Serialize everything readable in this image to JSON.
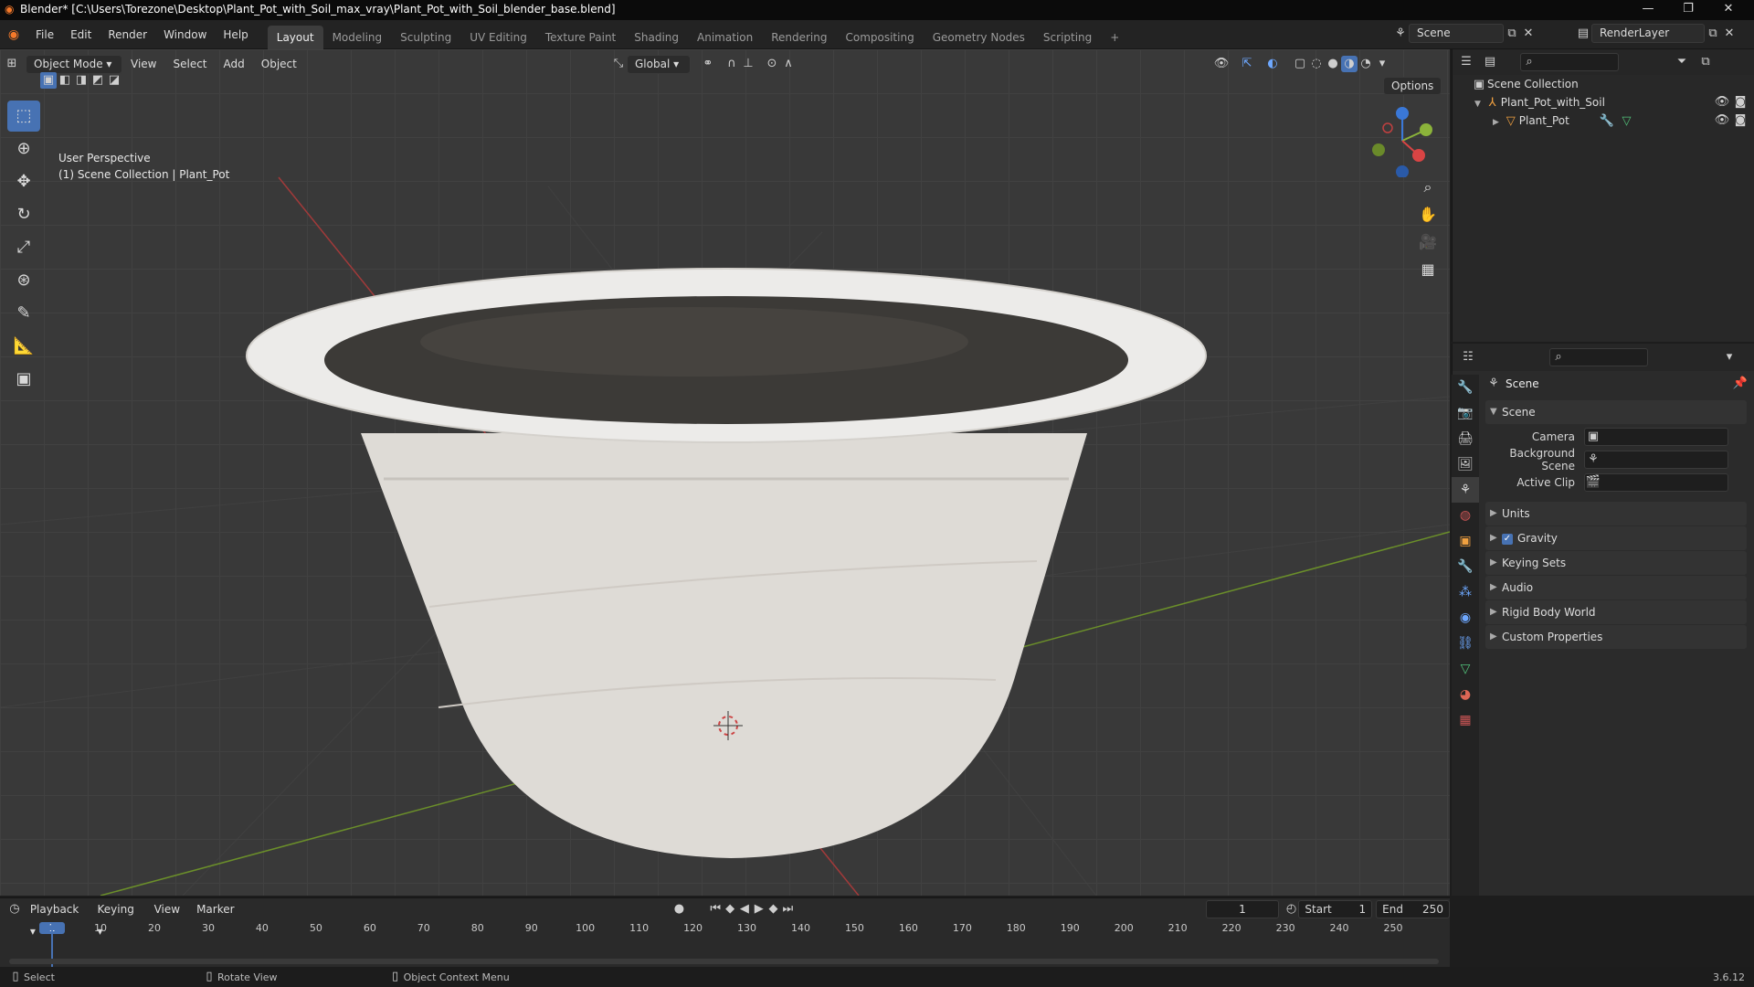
{
  "titlebar": {
    "title": "Blender* [C:\\Users\\Torezone\\Desktop\\Plant_Pot_with_Soil_max_vray\\Plant_Pot_with_Soil_blender_base.blend]"
  },
  "menus": [
    "File",
    "Edit",
    "Render",
    "Window",
    "Help"
  ],
  "workspaces": [
    "Layout",
    "Modeling",
    "Sculpting",
    "UV Editing",
    "Texture Paint",
    "Shading",
    "Animation",
    "Rendering",
    "Compositing",
    "Geometry Nodes",
    "Scripting"
  ],
  "scene": {
    "name": "Scene",
    "render_layer": "RenderLayer"
  },
  "viewport_header": {
    "mode": "Object Mode",
    "menus": [
      "View",
      "Select",
      "Add",
      "Object"
    ],
    "orientation": "Global",
    "options": "Options"
  },
  "viewport": {
    "perspective": "User Perspective",
    "collection_info": "(1) Scene Collection | Plant_Pot"
  },
  "outliner": {
    "root": "Scene Collection",
    "items": [
      "Plant_Pot_with_Soil",
      "Plant_Pot"
    ]
  },
  "properties": {
    "title": "Scene",
    "section": "Scene",
    "fields": {
      "camera": "Camera",
      "background_scene": "Background Scene",
      "active_clip": "Active Clip"
    },
    "panels": [
      "Units",
      "Gravity",
      "Keying Sets",
      "Audio",
      "Rigid Body World",
      "Custom Properties"
    ]
  },
  "timeline": {
    "menus": [
      "Playback",
      "Keying",
      "View",
      "Marker"
    ],
    "current_frame": "1",
    "start_label": "Start",
    "start": "1",
    "end_label": "End",
    "end": "250",
    "ticks": [
      "1",
      "10",
      "20",
      "30",
      "40",
      "50",
      "60",
      "70",
      "80",
      "90",
      "100",
      "110",
      "120",
      "130",
      "140",
      "150",
      "160",
      "170",
      "180",
      "190",
      "200",
      "210",
      "220",
      "230",
      "240",
      "250"
    ]
  },
  "statusbar": {
    "select": "Select",
    "rotate": "Rotate View",
    "context": "Object Context Menu",
    "version": "3.6.12"
  }
}
